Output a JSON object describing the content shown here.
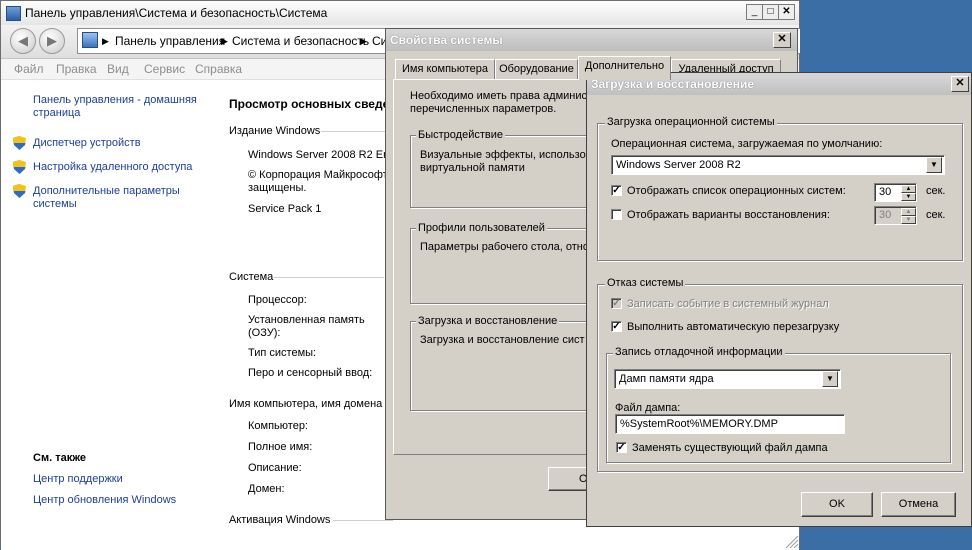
{
  "control_panel": {
    "title": "Панель управления\\Система и безопасность\\Система",
    "address": {
      "segments": [
        "Панель управления",
        "Система и безопасность",
        "Си"
      ]
    },
    "menu": [
      "Файл",
      "Правка",
      "Вид",
      "Сервис",
      "Справка"
    ],
    "left_links": {
      "home": "Панель управления - домашняя страница",
      "device_manager": "Диспетчер устройств",
      "remote": "Настройка удаленного доступа",
      "advanced": "Дополнительные параметры системы",
      "see_also": "См. также",
      "support": "Центр поддержки",
      "update": "Центр обновления Windows"
    },
    "main": {
      "heading": "Просмотр основных сведе",
      "edition_header": "Издание Windows",
      "edition": "Windows Server 2008 R2 En",
      "copyright": "© Корпорация Майкрософт",
      "rights": "защищены.",
      "service_pack": "Service Pack 1",
      "system_header": "Система",
      "processor": "Процессор:",
      "memory_1": "Установленная память",
      "memory_2": "(ОЗУ):",
      "system_type": "Тип системы:",
      "pen": "Перо и сенсорный ввод:",
      "computer_header": "Имя компьютера, имя домена и",
      "computer": "Компьютер:",
      "full_name": "Полное имя:",
      "description": "Описание:",
      "domain": "Домен:",
      "activation_header": "Активация Windows"
    }
  },
  "system_properties": {
    "title": "Свойства системы",
    "tabs": [
      "Имя компьютера",
      "Оборудование",
      "Дополнительно",
      "Удаленный доступ"
    ],
    "admin_note_1": "Необходимо иметь права админис",
    "admin_note_2": "перечисленных параметров.",
    "performance": {
      "title": "Быстродействие",
      "line1": "Визуальные эффекты, использов",
      "line2": "виртуальной памяти"
    },
    "profiles": {
      "title": "Профили пользователей",
      "line1": "Параметры рабочего стола, отно"
    },
    "startup": {
      "title": "Загрузка и восстановление",
      "line1": "Загрузка и восстановление сист"
    },
    "ok_partial": "О"
  },
  "startup_recovery": {
    "title": "Загрузка и восстановление",
    "os_group": "Загрузка операционной системы",
    "default_os_label": "Операционная система, загружаемая по умолчанию:",
    "default_os_value": "Windows Server 2008 R2",
    "show_list_label": "Отображать список операционных систем:",
    "show_list_checked": true,
    "show_list_seconds": "30",
    "show_recovery_label": "Отображать варианты восстановления:",
    "show_recovery_checked": false,
    "show_recovery_seconds": "30",
    "seconds_unit": "сек.",
    "failure_group": "Отказ системы",
    "write_event_label": "Записать событие в системный журнал",
    "write_event_checked": true,
    "auto_restart_label": "Выполнить автоматическую перезагрузку",
    "auto_restart_checked": true,
    "debug_group": "Запись отладочной информации",
    "debug_type_value": "Дамп памяти ядра",
    "dump_file_label": "Файл дампа:",
    "dump_file_value": "%SystemRoot%\\MEMORY.DMP",
    "overwrite_label": "Заменять существующий файл дампа",
    "overwrite_checked": true,
    "ok": "OK",
    "cancel": "Отмена"
  },
  "colors": {
    "desktop": "#3a6ea5",
    "dialog_face": "#d4d0c8",
    "link": "#1c3e9a"
  }
}
